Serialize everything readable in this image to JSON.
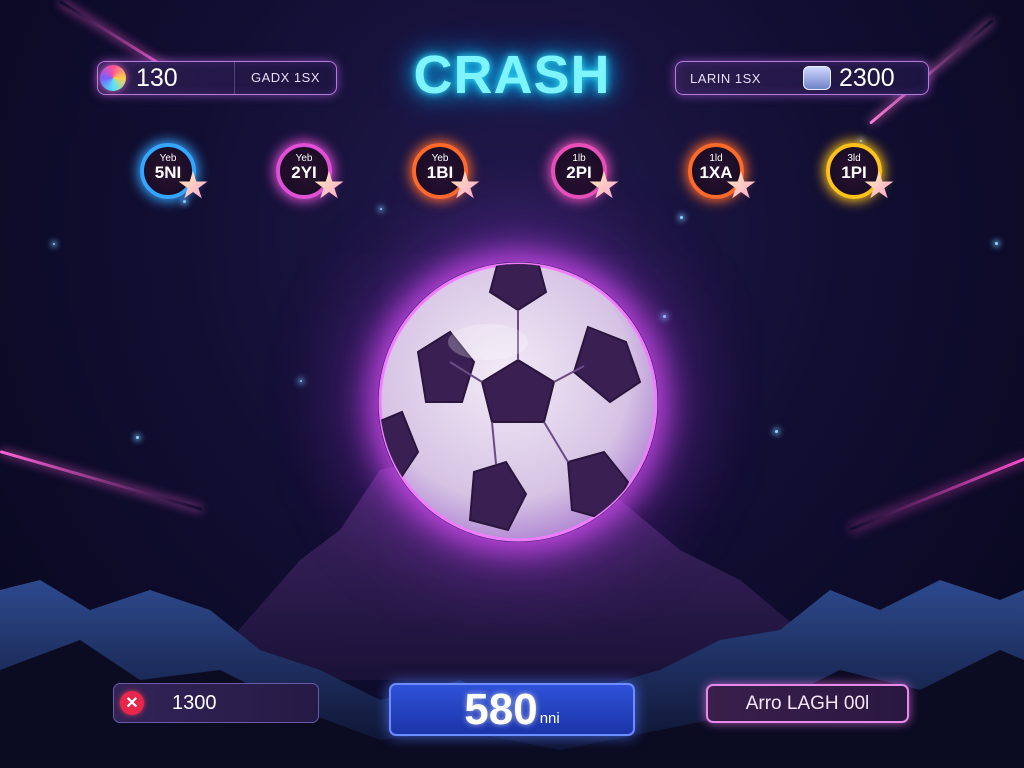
{
  "header": {
    "title": "CRASH",
    "left": {
      "value": "130",
      "label": "GADX 1SX"
    },
    "right": {
      "label": "LARIN 1SX",
      "value": "2300"
    }
  },
  "badges": [
    {
      "top": "Yeb",
      "value": "5NI",
      "color": "#35a6ff"
    },
    {
      "top": "Yeb",
      "value": "2YI",
      "color": "#e04fd6"
    },
    {
      "top": "Yeb",
      "value": "1BI",
      "color": "#ff6a2b"
    },
    {
      "top": "1lb",
      "value": "2PI",
      "color": "#e84fb8"
    },
    {
      "top": "1ld",
      "value": "1XA",
      "color": "#ff6a2b"
    },
    {
      "top": "3ld",
      "value": "1PI",
      "color": "#ffc21a"
    }
  ],
  "bottom": {
    "bet_amount": "1300",
    "multiplier_value": "580",
    "multiplier_unit": "nni",
    "auto_label": "Arro LAGH 00l"
  },
  "icons": {
    "left_coin": "coin-icon",
    "right_icon": "controller-icon",
    "cancel": "close-icon",
    "badge_star": "star-icon"
  },
  "colors": {
    "title_glow": "#33e4ff",
    "ball_glow": "#e050ff",
    "multiplier_bg": "#2f52d8",
    "cancel_red": "#e8254a"
  }
}
